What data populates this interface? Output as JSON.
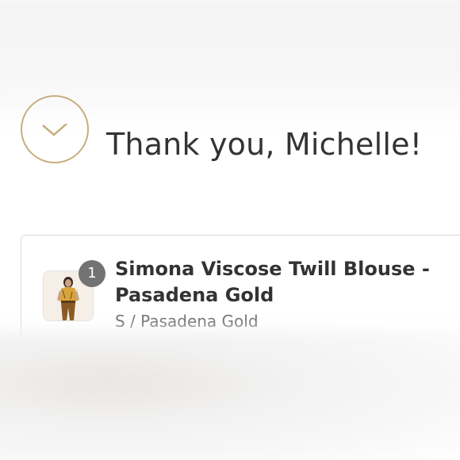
{
  "thank_you": {
    "message": "Thank you, Michelle!"
  },
  "order": {
    "items": [
      {
        "quantity": "1",
        "title": "Simona Viscose Twill Blouse - Pasadena Gold",
        "variant": "S / Pasadena Gold"
      }
    ]
  },
  "colors": {
    "accent": "#c7ad7e",
    "text": "#333333",
    "muted": "#737373",
    "badge": "#737373",
    "border": "#d9d9d9"
  },
  "icons": {
    "success": "check-icon",
    "product": "product-thumbnail"
  }
}
